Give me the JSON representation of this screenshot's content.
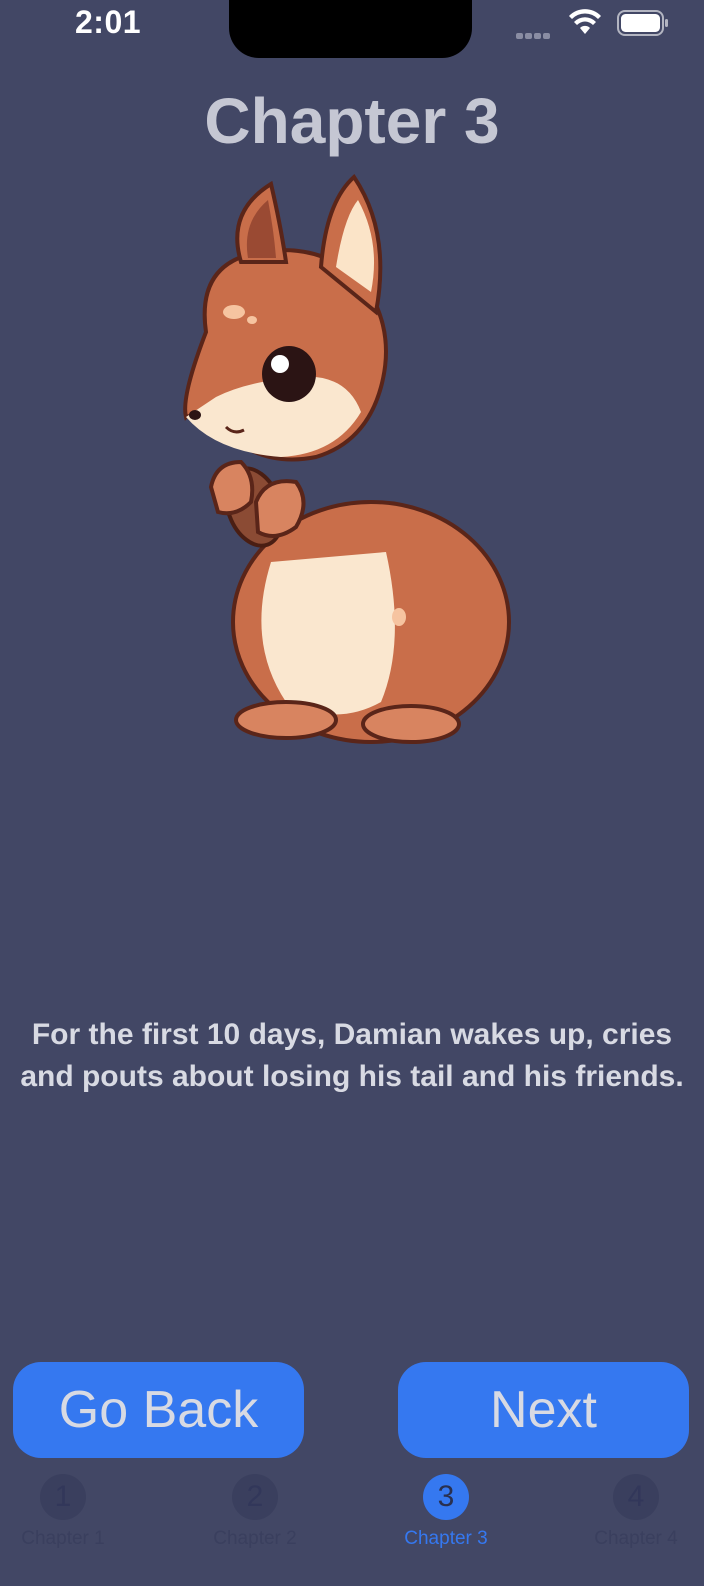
{
  "status_bar": {
    "time": "2:01"
  },
  "title": "Chapter 3",
  "illustration": {
    "subject": "squirrel-holding-acorn"
  },
  "story": {
    "lines": [
      "For the first 10 days, Damian wakes up, cries",
      "and pouts about losing his tail and his friends."
    ]
  },
  "buttons": {
    "back": "Go Back",
    "next": "Next"
  },
  "tabs": [
    {
      "number": "1",
      "label": "Chapter 1",
      "active": false
    },
    {
      "number": "2",
      "label": "Chapter 2",
      "active": false
    },
    {
      "number": "3",
      "label": "Chapter 3",
      "active": true
    },
    {
      "number": "4",
      "label": "Chapter 4",
      "active": false
    }
  ],
  "colors": {
    "background": "#424765",
    "accent": "#3578f0",
    "title_text": "#c5c7d3"
  }
}
